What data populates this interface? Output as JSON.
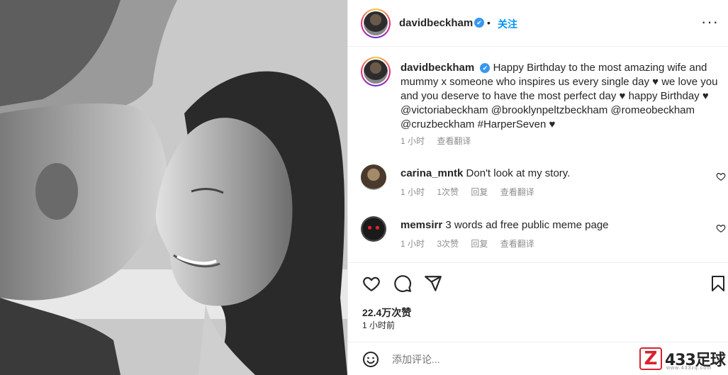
{
  "post": {
    "author": "davidbeckham",
    "verified_glyph": "✔",
    "separator": "•",
    "follow_label": "关注",
    "more_glyph": "···"
  },
  "caption": {
    "username": "davidbeckham",
    "text": "Happy Birthday to the most amazing wife and mummy x someone who inspires us every single day ♥ we love you and you deserve to have the most perfect day ♥ happy Birthday ♥ @victoriabeckham @brooklynpeltzbeckham @romeobeckham @cruzbeckham #HarperSeven ♥",
    "time": "1 小时",
    "translate": "查看翻译"
  },
  "comments": [
    {
      "username": "carina_mntk",
      "text": "Don't look at my story.",
      "time": "1 小时",
      "likes": "1次赞",
      "reply": "回复",
      "translate": "查看翻译"
    },
    {
      "username": "memsirr",
      "text": "3 words ad free public meme page",
      "time": "1 小时",
      "likes": "3次赞",
      "reply": "回复",
      "translate": "查看翻译"
    }
  ],
  "engagement": {
    "likes": "22.4万次赞",
    "time_ago": "1 小时前"
  },
  "add_comment": {
    "placeholder": "添加评论..."
  },
  "watermark": {
    "logo_letter": "Z",
    "title": "433足球",
    "sub": "www.433zq.com"
  },
  "colors": {
    "link_blue": "#0095f6",
    "verified_blue": "#3897f0",
    "meta_gray": "#8e8e8e",
    "watermark_red": "#d9232f"
  },
  "icons": [
    "heart-icon",
    "comment-icon",
    "share-icon",
    "bookmark-icon",
    "emoji-icon",
    "more-icon",
    "verified-icon"
  ]
}
